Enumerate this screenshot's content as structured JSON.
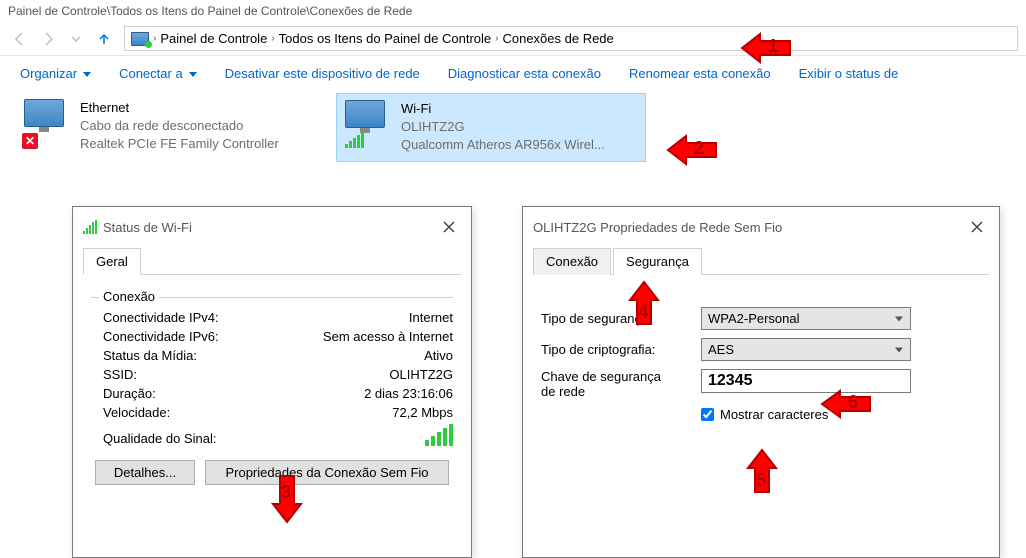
{
  "window": {
    "title": "Painel de Controle\\Todos os Itens do Painel de Controle\\Conexões de Rede"
  },
  "breadcrumb": {
    "a": "Painel de Controle",
    "b": "Todos os Itens do Painel de Controle",
    "c": "Conexões de Rede"
  },
  "toolbar": {
    "organize": "Organizar",
    "connect": "Conectar a",
    "disable": "Desativar este dispositivo de rede",
    "diagnose": "Diagnosticar esta conexão",
    "rename": "Renomear esta conexão",
    "status": "Exibir o status de"
  },
  "adapters": {
    "eth": {
      "name": "Ethernet",
      "line2": "Cabo da rede desconectado",
      "line3": "Realtek PCIe FE Family Controller"
    },
    "wifi": {
      "name": "Wi-Fi",
      "line2": "OLIHTZ2G",
      "line3": "Qualcomm Atheros AR956x Wirel..."
    }
  },
  "statusDlg": {
    "title": "Status de Wi-Fi",
    "tab_general": "Geral",
    "group_conn": "Conexão",
    "ipv4_k": "Conectividade IPv4:",
    "ipv4_v": "Internet",
    "ipv6_k": "Conectividade IPv6:",
    "ipv6_v": "Sem acesso à Internet",
    "media_k": "Status da Mídia:",
    "media_v": "Ativo",
    "ssid_k": "SSID:",
    "ssid_v": "OLIHTZ2G",
    "dur_k": "Duração:",
    "dur_v": "2 dias 23:16:06",
    "speed_k": "Velocidade:",
    "speed_v": "72,2 Mbps",
    "sig_k": "Qualidade do Sinal:",
    "btn_details": "Detalhes...",
    "btn_wprops": "Propriedades da Conexão Sem Fio"
  },
  "propsDlg": {
    "title_prefix": "OLIHTZ2G Propriedades de Rede Sem Fio",
    "tab_conn": "Conexão",
    "tab_sec": "Segurança",
    "sectype_k": "Tipo de segurança:",
    "sectype_v": "WPA2-Personal",
    "enc_k": "Tipo de criptografia:",
    "enc_v": "AES",
    "key_k1": "Chave de segurança",
    "key_k2": "de rede",
    "key_v": "12345",
    "show_chars": "Mostrar caracteres"
  },
  "annotations": {
    "n1": "1",
    "n2": "2",
    "n3": "3",
    "n4": "4",
    "n5": "5",
    "n6": "6"
  }
}
